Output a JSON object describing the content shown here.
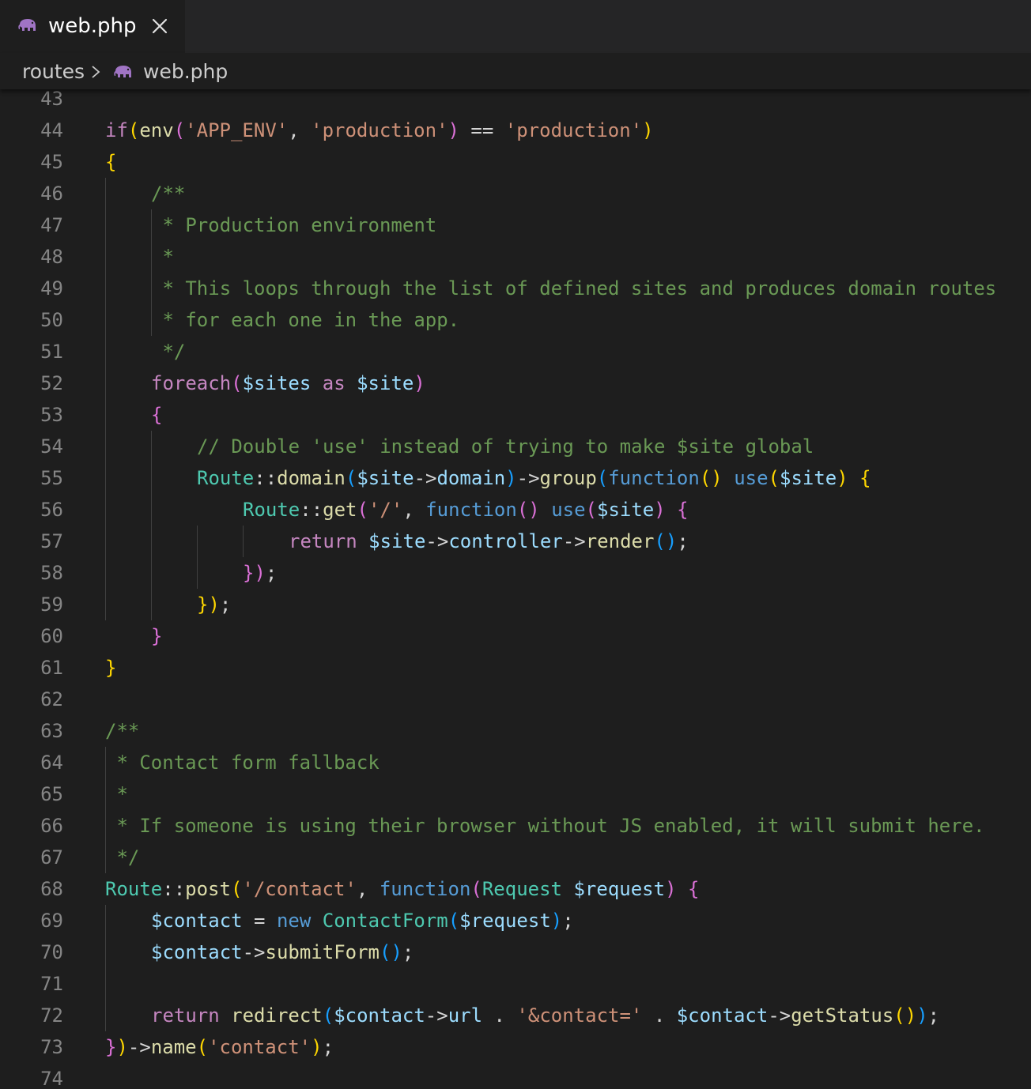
{
  "tab": {
    "title": "web.php",
    "icon": "elephant-php-icon",
    "close_icon": "close-icon"
  },
  "breadcrumb": {
    "folder": "routes",
    "file": "web.php",
    "separator_icon": "chevron-right-icon",
    "file_icon": "elephant-php-icon"
  },
  "colors": {
    "keyword": "#569cd6",
    "control": "#c586c0",
    "function": "#dcdcaa",
    "variable": "#9cdcfe",
    "string": "#ce9178",
    "comment": "#6a9955",
    "class": "#4ec9b0",
    "punct": "#d4d4d4",
    "bracket1": "#ffd700",
    "bracket2": "#da70d6",
    "bracket3": "#179fff",
    "line_number": "#858585"
  },
  "editor": {
    "lines": [
      {
        "n": "43",
        "indent": 0,
        "tokens": []
      },
      {
        "n": "44",
        "indent": 0,
        "tokens": [
          [
            "if",
            "control"
          ],
          [
            "(",
            "b1"
          ],
          [
            "env",
            "function"
          ],
          [
            "(",
            "b2"
          ],
          [
            "'APP_ENV'",
            "string"
          ],
          [
            ", ",
            "punct"
          ],
          [
            "'production'",
            "string"
          ],
          [
            ")",
            "b2"
          ],
          [
            " == ",
            "punct"
          ],
          [
            "'production'",
            "string"
          ],
          [
            ")",
            "b1"
          ]
        ]
      },
      {
        "n": "45",
        "indent": 0,
        "tokens": [
          [
            "{",
            "b1"
          ]
        ]
      },
      {
        "n": "46",
        "indent": 1,
        "tokens": [
          [
            "/**",
            "comment"
          ]
        ]
      },
      {
        "n": "47",
        "indent": 1,
        "tokens": [
          [
            " * Production environment",
            "comment"
          ]
        ]
      },
      {
        "n": "48",
        "indent": 1,
        "tokens": [
          [
            " *",
            "comment"
          ]
        ]
      },
      {
        "n": "49",
        "indent": 1,
        "tokens": [
          [
            " * This loops through the list of defined sites and produces domain routes",
            "comment"
          ]
        ]
      },
      {
        "n": "50",
        "indent": 1,
        "tokens": [
          [
            " * for each one in the app.",
            "comment"
          ]
        ]
      },
      {
        "n": "51",
        "indent": 1,
        "tokens": [
          [
            " */",
            "comment"
          ]
        ]
      },
      {
        "n": "52",
        "indent": 1,
        "tokens": [
          [
            "foreach",
            "control"
          ],
          [
            "(",
            "b2"
          ],
          [
            "$sites",
            "variable"
          ],
          [
            " as ",
            "control"
          ],
          [
            "$site",
            "variable"
          ],
          [
            ")",
            "b2"
          ]
        ]
      },
      {
        "n": "53",
        "indent": 1,
        "tokens": [
          [
            "{",
            "b2"
          ]
        ]
      },
      {
        "n": "54",
        "indent": 2,
        "tokens": [
          [
            "// Double 'use' instead of trying to make $site global",
            "comment"
          ]
        ]
      },
      {
        "n": "55",
        "indent": 2,
        "tokens": [
          [
            "Route",
            "class"
          ],
          [
            "::",
            "punct"
          ],
          [
            "domain",
            "function"
          ],
          [
            "(",
            "b3"
          ],
          [
            "$site",
            "variable"
          ],
          [
            "->",
            "punct"
          ],
          [
            "domain",
            "variable"
          ],
          [
            ")",
            "b3"
          ],
          [
            "->",
            "punct"
          ],
          [
            "group",
            "function"
          ],
          [
            "(",
            "b3"
          ],
          [
            "function",
            "keyword"
          ],
          [
            "()",
            "b1"
          ],
          [
            " ",
            "punct"
          ],
          [
            "use",
            "keyword"
          ],
          [
            "(",
            "b1"
          ],
          [
            "$site",
            "variable"
          ],
          [
            ")",
            "b1"
          ],
          [
            " ",
            "punct"
          ],
          [
            "{",
            "b1"
          ]
        ]
      },
      {
        "n": "56",
        "indent": 3,
        "tokens": [
          [
            "Route",
            "class"
          ],
          [
            "::",
            "punct"
          ],
          [
            "get",
            "function"
          ],
          [
            "(",
            "b2"
          ],
          [
            "'/'",
            "string"
          ],
          [
            ", ",
            "punct"
          ],
          [
            "function",
            "keyword"
          ],
          [
            "()",
            "b2"
          ],
          [
            " ",
            "punct"
          ],
          [
            "use",
            "keyword"
          ],
          [
            "(",
            "b2"
          ],
          [
            "$site",
            "variable"
          ],
          [
            ")",
            "b2"
          ],
          [
            " ",
            "punct"
          ],
          [
            "{",
            "b2"
          ]
        ]
      },
      {
        "n": "57",
        "indent": 4,
        "tokens": [
          [
            "return",
            "control"
          ],
          [
            " ",
            "punct"
          ],
          [
            "$site",
            "variable"
          ],
          [
            "->",
            "punct"
          ],
          [
            "controller",
            "variable"
          ],
          [
            "->",
            "punct"
          ],
          [
            "render",
            "function"
          ],
          [
            "()",
            "b3"
          ],
          [
            ";",
            "punct"
          ]
        ]
      },
      {
        "n": "58",
        "indent": 3,
        "tokens": [
          [
            "}",
            "b2"
          ],
          [
            ")",
            "b2"
          ],
          [
            ";",
            "punct"
          ]
        ]
      },
      {
        "n": "59",
        "indent": 2,
        "tokens": [
          [
            "}",
            "b1"
          ],
          [
            ")",
            "b1"
          ],
          [
            ";",
            "punct"
          ]
        ]
      },
      {
        "n": "60",
        "indent": 1,
        "tokens": [
          [
            "}",
            "b2"
          ]
        ]
      },
      {
        "n": "61",
        "indent": 0,
        "tokens": [
          [
            "}",
            "b1"
          ]
        ]
      },
      {
        "n": "62",
        "indent": 0,
        "tokens": []
      },
      {
        "n": "63",
        "indent": 0,
        "tokens": [
          [
            "/**",
            "comment"
          ]
        ]
      },
      {
        "n": "64",
        "indent": 0,
        "tokens": [
          [
            " * Contact form fallback",
            "comment"
          ]
        ]
      },
      {
        "n": "65",
        "indent": 0,
        "tokens": [
          [
            " *",
            "comment"
          ]
        ]
      },
      {
        "n": "66",
        "indent": 0,
        "tokens": [
          [
            " * If someone is using their browser without JS enabled, it will submit here.",
            "comment"
          ]
        ]
      },
      {
        "n": "67",
        "indent": 0,
        "tokens": [
          [
            " */",
            "comment"
          ]
        ]
      },
      {
        "n": "68",
        "indent": 0,
        "tokens": [
          [
            "Route",
            "class"
          ],
          [
            "::",
            "punct"
          ],
          [
            "post",
            "function"
          ],
          [
            "(",
            "b1"
          ],
          [
            "'/contact'",
            "string"
          ],
          [
            ", ",
            "punct"
          ],
          [
            "function",
            "keyword"
          ],
          [
            "(",
            "b2"
          ],
          [
            "Request",
            "class"
          ],
          [
            " ",
            "punct"
          ],
          [
            "$request",
            "variable"
          ],
          [
            ")",
            "b2"
          ],
          [
            " ",
            "punct"
          ],
          [
            "{",
            "b2"
          ]
        ]
      },
      {
        "n": "69",
        "indent": 1,
        "tokens": [
          [
            "$contact",
            "variable"
          ],
          [
            " = ",
            "punct"
          ],
          [
            "new",
            "keyword"
          ],
          [
            " ",
            "punct"
          ],
          [
            "ContactForm",
            "class"
          ],
          [
            "(",
            "b3"
          ],
          [
            "$request",
            "variable"
          ],
          [
            ")",
            "b3"
          ],
          [
            ";",
            "punct"
          ]
        ]
      },
      {
        "n": "70",
        "indent": 1,
        "tokens": [
          [
            "$contact",
            "variable"
          ],
          [
            "->",
            "punct"
          ],
          [
            "submitForm",
            "function"
          ],
          [
            "()",
            "b3"
          ],
          [
            ";",
            "punct"
          ]
        ]
      },
      {
        "n": "71",
        "indent": 0,
        "tokens": []
      },
      {
        "n": "72",
        "indent": 1,
        "tokens": [
          [
            "return",
            "control"
          ],
          [
            " ",
            "punct"
          ],
          [
            "redirect",
            "function"
          ],
          [
            "(",
            "b3"
          ],
          [
            "$contact",
            "variable"
          ],
          [
            "->",
            "punct"
          ],
          [
            "url",
            "variable"
          ],
          [
            " . ",
            "punct"
          ],
          [
            "'&contact='",
            "string"
          ],
          [
            " . ",
            "punct"
          ],
          [
            "$contact",
            "variable"
          ],
          [
            "->",
            "punct"
          ],
          [
            "getStatus",
            "function"
          ],
          [
            "()",
            "b1"
          ],
          [
            ")",
            "b3"
          ],
          [
            ";",
            "punct"
          ]
        ]
      },
      {
        "n": "73",
        "indent": 0,
        "tokens": [
          [
            "}",
            "b2"
          ],
          [
            ")",
            "b1"
          ],
          [
            "->",
            "punct"
          ],
          [
            "name",
            "function"
          ],
          [
            "(",
            "b1"
          ],
          [
            "'contact'",
            "string"
          ],
          [
            ")",
            "b1"
          ],
          [
            ";",
            "punct"
          ]
        ]
      },
      {
        "n": "74",
        "indent": 0,
        "tokens": []
      }
    ]
  }
}
